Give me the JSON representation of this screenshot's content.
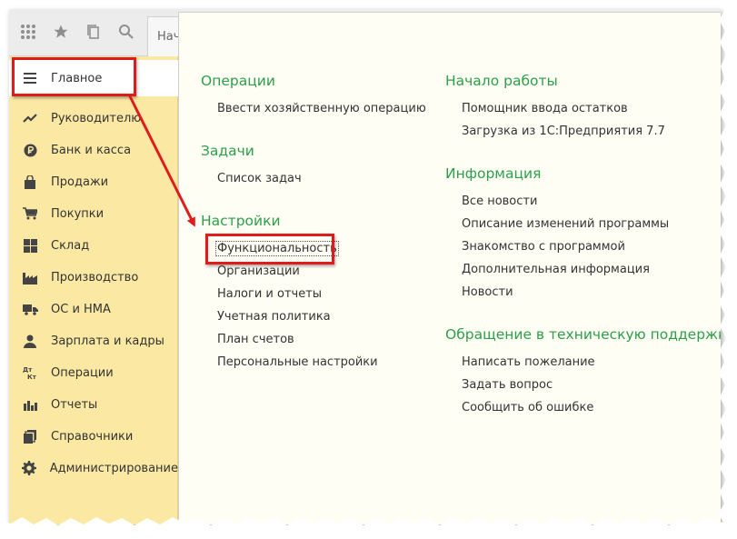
{
  "topbar": {
    "apps_icon": "grid-icon",
    "favorites_icon": "star-icon",
    "history_icon": "history-icon",
    "search_icon": "search-icon",
    "tab_label": "Нач"
  },
  "sidebar": {
    "items": [
      {
        "label": "Главное",
        "icon": "menu-lines-icon"
      },
      {
        "label": "Руководителю",
        "icon": "trend-icon"
      },
      {
        "label": "Банк и касса",
        "icon": "ruble-icon"
      },
      {
        "label": "Продажи",
        "icon": "bag-icon"
      },
      {
        "label": "Покупки",
        "icon": "cart-icon"
      },
      {
        "label": "Склад",
        "icon": "warehouse-icon"
      },
      {
        "label": "Производство",
        "icon": "factory-icon"
      },
      {
        "label": "ОС и НМА",
        "icon": "truck-icon"
      },
      {
        "label": "Зарплата и кадры",
        "icon": "person-icon"
      },
      {
        "label": "Операции",
        "icon": "dt-kt-icon"
      },
      {
        "label": "Отчеты",
        "icon": "bar-chart-icon"
      },
      {
        "label": "Справочники",
        "icon": "books-icon"
      },
      {
        "label": "Администрирование",
        "icon": "gear-icon"
      }
    ]
  },
  "panel": {
    "left": {
      "operations_title": "Операции",
      "operations_items": [
        "Ввести хозяйственную операцию"
      ],
      "tasks_title": "Задачи",
      "tasks_items": [
        "Список задач"
      ],
      "settings_title": "Настройки",
      "settings_items": [
        "Функциональность",
        "Организации",
        "Налоги и отчеты",
        "Учетная политика",
        "План счетов",
        "Персональные настройки"
      ]
    },
    "right": {
      "start_title": "Начало работы",
      "start_items": [
        "Помощник ввода остатков",
        "Загрузка из 1С:Предприятия 7.7"
      ],
      "info_title": "Информация",
      "info_items": [
        "Все новости",
        "Описание изменений программы",
        "Знакомство с программой",
        "Дополнительная информация",
        "Новости"
      ],
      "support_title": "Обращение в техническую поддержку",
      "support_items": [
        "Написать пожелание",
        "Задать вопрос",
        "Сообщить об ошибке"
      ]
    }
  },
  "colors": {
    "sidebar_bg": "#fbe9a3",
    "section_title": "#2e9e49",
    "highlight": "#e01b1b"
  }
}
